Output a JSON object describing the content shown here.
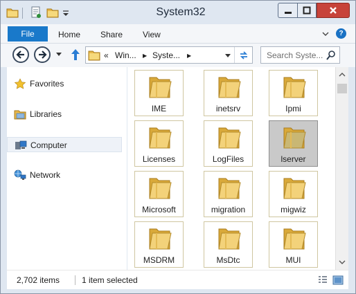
{
  "window": {
    "title": "System32"
  },
  "ribbon": {
    "tabs": [
      {
        "label": "File"
      },
      {
        "label": "Home"
      },
      {
        "label": "Share"
      },
      {
        "label": "View"
      }
    ],
    "help_label": "?"
  },
  "address": {
    "overflow": "«",
    "crumbs": [
      "Win...",
      "Syste..."
    ],
    "separator": "▶"
  },
  "search": {
    "placeholder": "Search Syste..."
  },
  "nav_pane": {
    "items": [
      {
        "label": "Favorites",
        "icon": "star-icon"
      },
      {
        "label": "Libraries",
        "icon": "libraries-icon"
      },
      {
        "label": "Computer",
        "icon": "computer-icon"
      },
      {
        "label": "Network",
        "icon": "network-icon"
      }
    ]
  },
  "folders": [
    {
      "name": "IME"
    },
    {
      "name": "inetsrv"
    },
    {
      "name": "Ipmi"
    },
    {
      "name": "Licenses"
    },
    {
      "name": "LogFiles"
    },
    {
      "name": "lserver",
      "selected": true
    },
    {
      "name": "Microsoft"
    },
    {
      "name": "migration"
    },
    {
      "name": "migwiz"
    },
    {
      "name": "MSDRM"
    },
    {
      "name": "MsDtc"
    },
    {
      "name": "MUI"
    }
  ],
  "status": {
    "item_count": "2,702 items",
    "selection": "1 item selected"
  },
  "colors": {
    "accent": "#1979ca",
    "close": "#c7433a",
    "folder": "#f3d27a",
    "selected": "#c9c9c9"
  }
}
